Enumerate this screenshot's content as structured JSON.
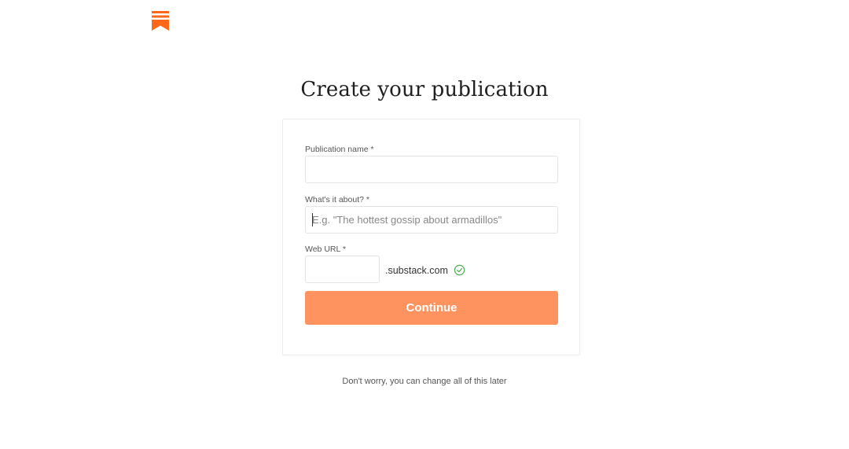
{
  "brand": {
    "logo_icon": "bookmark-logo-icon",
    "accent_color": "#ff6719"
  },
  "page": {
    "title": "Create your publication",
    "footnote": "Don't worry, you can change all of this later"
  },
  "form": {
    "publication_name": {
      "label": "Publication name *",
      "value": "",
      "placeholder": ""
    },
    "about": {
      "label": "What's it about? *",
      "value": "",
      "placeholder": "E.g. \"The hottest gossip about armadillos\""
    },
    "web_url": {
      "label": "Web URL *",
      "value": "",
      "suffix": ".substack.com",
      "status_icon": "check-circle-icon",
      "status_color": "#4caf50"
    },
    "continue_label": "Continue",
    "button_color": "#ff9360"
  }
}
